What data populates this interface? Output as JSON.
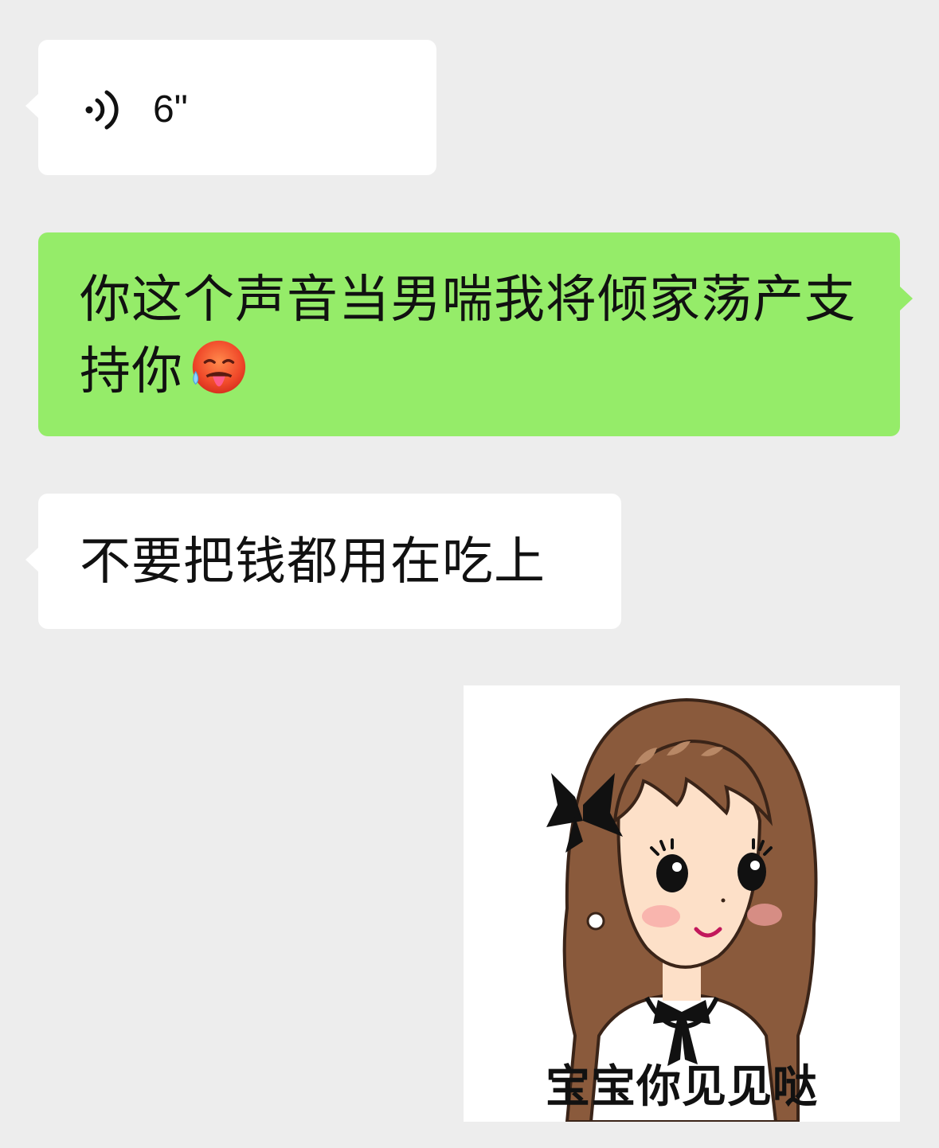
{
  "messages": {
    "voice": {
      "icon": "voice-wave-icon",
      "duration": "6\""
    },
    "green": {
      "text": "你这个声音当男喘我将倾家荡产支持你",
      "emoji": "hot-face-emoji"
    },
    "white": {
      "text": "不要把钱都用在吃上"
    },
    "sticker": {
      "caption": "宝宝你见见哒"
    }
  },
  "colors": {
    "background": "#ededed",
    "incoming_bubble": "#ffffff",
    "outgoing_bubble": "#95ec69",
    "text": "#111111"
  }
}
